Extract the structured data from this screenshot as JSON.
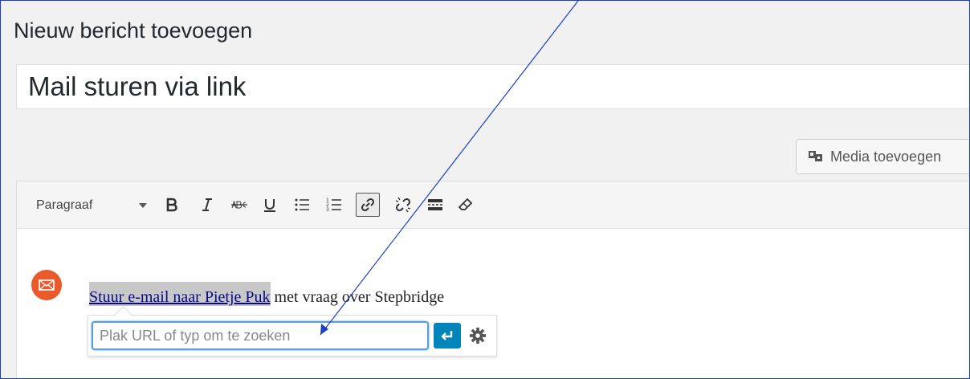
{
  "page": {
    "title": "Nieuw bericht toevoegen"
  },
  "post": {
    "title_value": "Mail sturen via link"
  },
  "media": {
    "label": "Media toevoegen"
  },
  "toolbar": {
    "format_value": "Paragraaf",
    "buttons": [
      "bold",
      "italic",
      "strikethrough",
      "underline",
      "bulleted-list",
      "numbered-list",
      "insert-link",
      "remove-link",
      "read-more",
      "clear-formatting"
    ]
  },
  "content": {
    "link_text": "Stuur e-mail naar Pietje Puk",
    "rest_text": " met vraag over Stepbridge"
  },
  "link_popup": {
    "placeholder": "Plak URL of typ om te zoeken"
  },
  "colors": {
    "accent": "#0085ba",
    "mail_icon_bg": "#ea5a2a",
    "annotation_arrow": "#1a3fbf"
  }
}
